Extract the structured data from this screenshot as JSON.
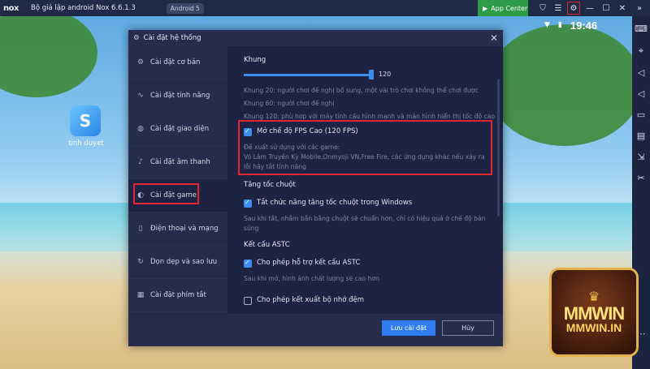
{
  "topbar": {
    "logo": "nox",
    "title": "Bộ giả lập android Nox 6.6.1.3",
    "android_badge": "Android 5",
    "app_center": "App Center"
  },
  "status_bar": {
    "time": "19:46"
  },
  "desktop": {
    "app_label": "tinh duyet"
  },
  "watermark": {
    "line1": "MMWIN",
    "line2": "MMWIN.IN"
  },
  "dialog": {
    "title": "Cài đặt hệ thống",
    "nav": [
      {
        "label": "Cài đặt cơ bản",
        "icon": "gear-icon"
      },
      {
        "label": "Cài đặt tính năng",
        "icon": "pulse-icon"
      },
      {
        "label": "Cài đặt giao diện",
        "icon": "palette-icon"
      },
      {
        "label": "Cài đặt âm thanh",
        "icon": "speaker-icon"
      },
      {
        "label": "Cài đặt game",
        "icon": "game-icon"
      },
      {
        "label": "Điện thoại và mạng",
        "icon": "phone-icon"
      },
      {
        "label": "Dọn dẹp và sao lưu",
        "icon": "cleanup-icon"
      },
      {
        "label": "Cài đặt phím tắt",
        "icon": "keyboard-icon"
      }
    ],
    "active_nav_index": 4,
    "frame": {
      "title": "Khung",
      "value": "120",
      "fill_fraction": 1.0,
      "desc_20": "Khung 20: người chơi đề nghị bổ sung, một vài trò chơi không thể chơi được",
      "desc_60": "Khung 60: người chơi đề nghị",
      "desc_120": "Khung 120: phù hợp với máy tính cấu hình mạnh và màn hình hiển thị tốc độ cao"
    },
    "fps": {
      "label": "Mở chế độ FPS Cao (120 FPS)",
      "checked": true,
      "desc1": "Đề xuất sử dụng với các game:",
      "desc2": "Võ Lâm Truyền Kỳ Mobile,Onmyoji VN,Free Fire, các ứng dụng khác nếu xảy ra",
      "desc3": "lỗi hãy tắt tính năng"
    },
    "mouse": {
      "title": "Tăng tốc chuột",
      "label": "Tắt chức năng tăng tốc chuột trong Windows",
      "checked": true,
      "desc1": "Sau khi tắt, nhắm bắn bằng chuột sẽ chuẩn hơn, chỉ có hiệu quả ở chế độ bản",
      "desc2": "súng"
    },
    "astc": {
      "title": "Kết cấu ASTC",
      "label": "Cho phép hỗ trợ kết cấu ASTC",
      "checked": true,
      "desc": "Sau khi mở, hình ảnh chất lượng sẽ cao hơn"
    },
    "cache": {
      "label": "Cho phép kết xuất bộ nhớ đệm",
      "checked": false
    },
    "save_label": "Lưu cài đặt",
    "cancel_label": "Hủy"
  },
  "colors": {
    "accent": "#2f7df0",
    "highlight": "#e0262c",
    "dialog_bg": "#262c4c",
    "content_bg": "#1e2343"
  }
}
